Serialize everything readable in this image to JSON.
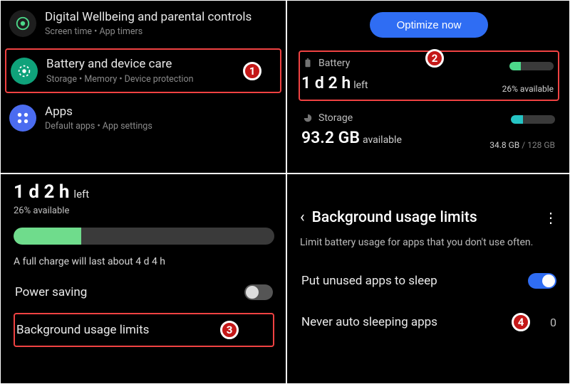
{
  "panel1": {
    "items": [
      {
        "title": "Digital Wellbeing and parental controls",
        "sub": "Screen time  •  App timers"
      },
      {
        "title": "Battery and device care",
        "sub": "Storage  •  Memory  •  Device protection"
      },
      {
        "title": "Apps",
        "sub": "Default apps  •  App settings"
      }
    ]
  },
  "panel2": {
    "optimize": "Optimize now",
    "battery": {
      "label": "Battery",
      "stat": "1 d 2 h",
      "stat_suffix": "left",
      "available_text": "26% available",
      "percent": 26
    },
    "storage": {
      "label": "Storage",
      "stat": "93.2 GB",
      "stat_suffix": "available",
      "used_text": "34.8 GB",
      "total_text": " / 128 GB",
      "percent": 27
    }
  },
  "panel3": {
    "stat": "1 d 2 h",
    "stat_suffix": "left",
    "available_text": "26% available",
    "percent": 26,
    "full_charge_note": "A full charge will last about 4 d 4 h",
    "rows": {
      "power_saving": "Power saving",
      "bg_limits": "Background usage limits"
    }
  },
  "panel4": {
    "title": "Background usage limits",
    "desc": "Limit battery usage for apps that you don't use often.",
    "rows": {
      "put_sleep": "Put unused apps to sleep",
      "never_sleep": "Never auto sleeping apps",
      "never_sleep_count": "0"
    }
  },
  "steps": {
    "s1": "1",
    "s2": "2",
    "s3": "3",
    "s4": "4"
  }
}
